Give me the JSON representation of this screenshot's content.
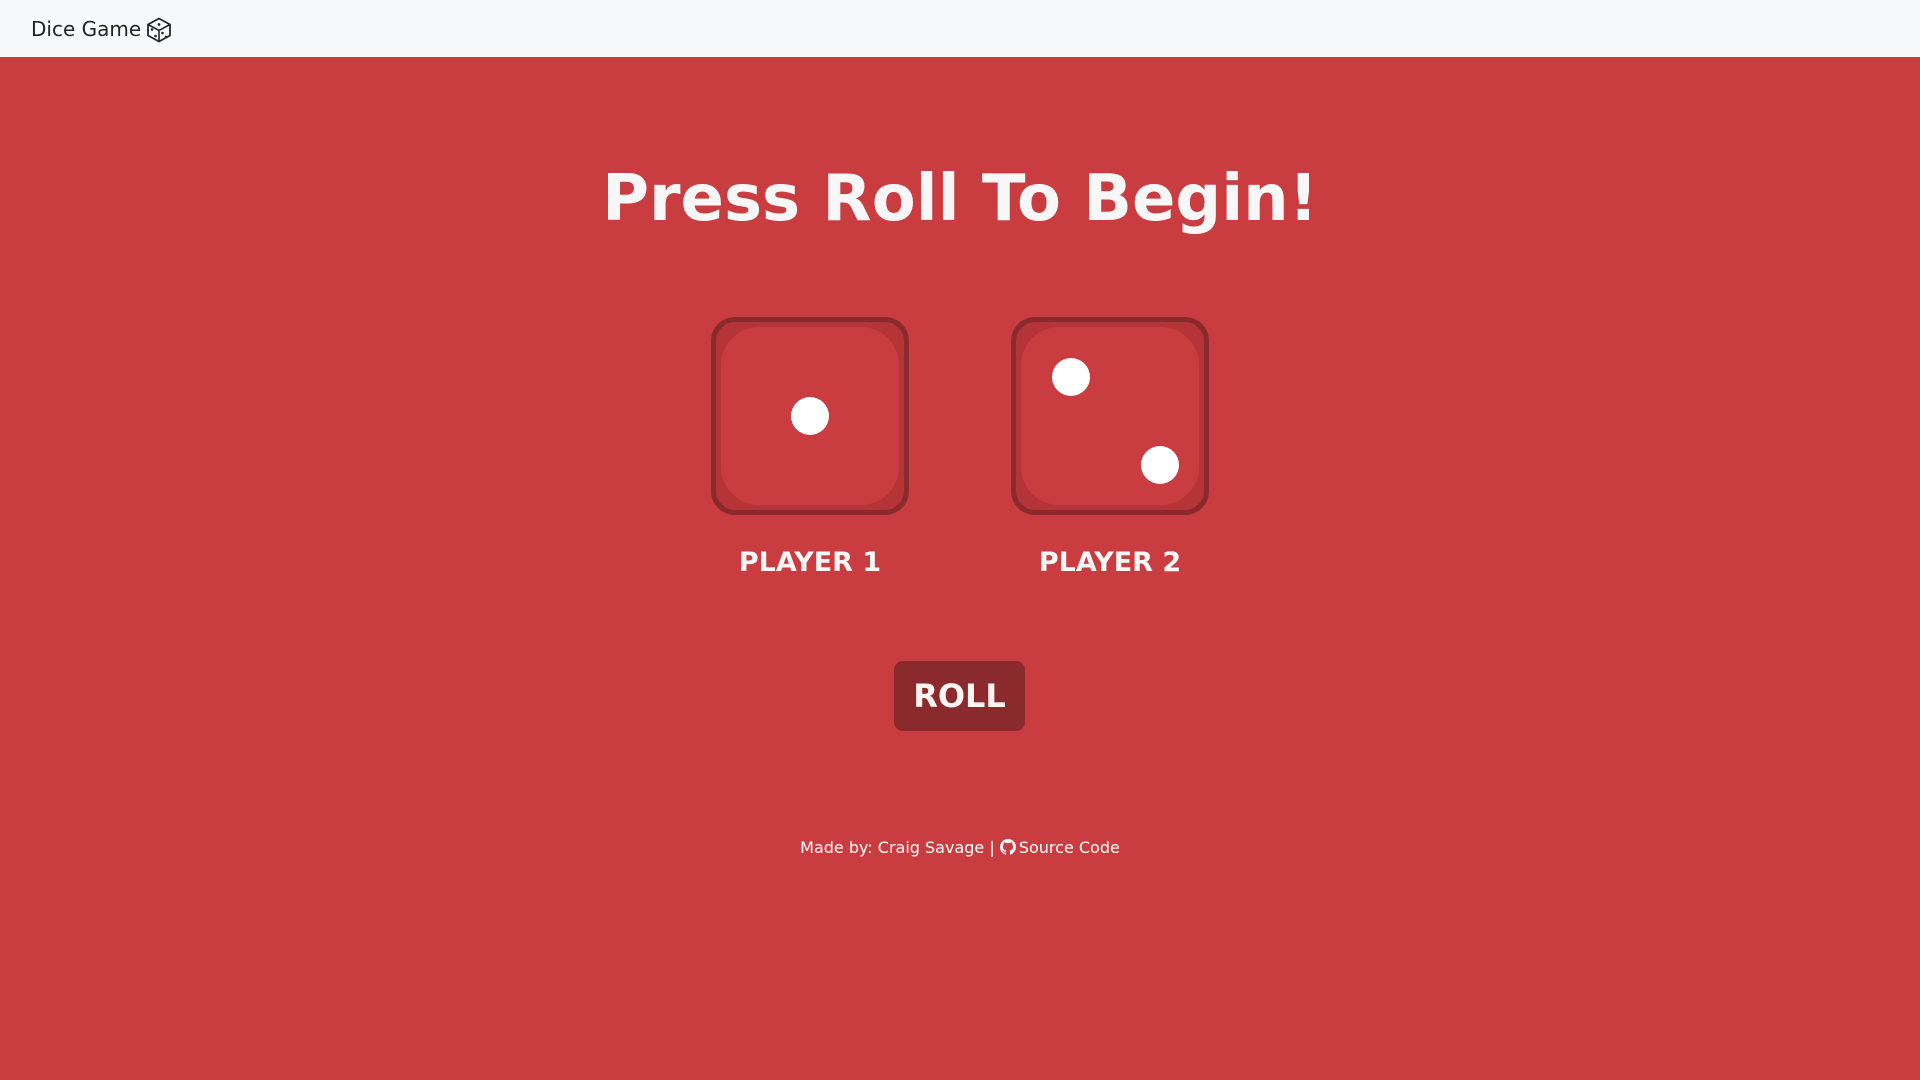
{
  "navbar": {
    "brand": "Dice Game",
    "brand_icon": "dice-icon"
  },
  "title": "Press Roll To Begin!",
  "players": [
    {
      "label": "PLAYER 1",
      "die_value": 1
    },
    {
      "label": "PLAYER 2",
      "die_value": 2
    }
  ],
  "roll_button": "ROLL",
  "footer": {
    "made_by_prefix": "Made by:",
    "author": "Craig Savage",
    "separator": "|",
    "source_icon": "github-icon",
    "source_label": "Source Code"
  },
  "colors": {
    "background": "#c93c3f",
    "die_border": "#8b2a2d",
    "navbar": "#f8f9fa",
    "text": "#f7f7f7"
  }
}
